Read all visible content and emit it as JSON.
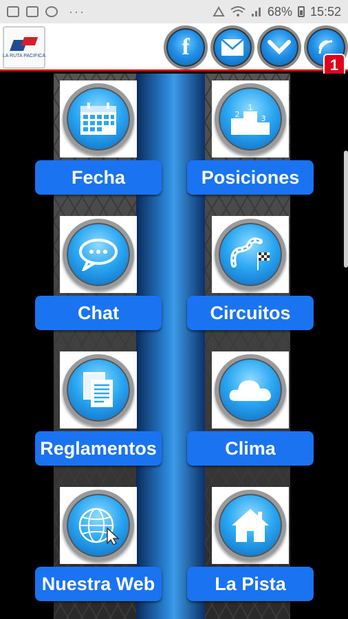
{
  "status_bar": {
    "battery": "68%",
    "time": "15:52",
    "more": "···"
  },
  "header": {
    "logo_text": "LA RUTA PACIFICA",
    "notification_count": "1",
    "buttons": [
      {
        "icon": "facebook-icon",
        "glyph": "f"
      },
      {
        "icon": "mail-icon"
      },
      {
        "icon": "down-arrow-icon"
      },
      {
        "icon": "rss-icon"
      }
    ]
  },
  "menu": {
    "items": [
      {
        "label": "Fecha",
        "icon": "calendar-icon"
      },
      {
        "label": "Posiciones",
        "icon": "podium-icon"
      },
      {
        "label": "Chat",
        "icon": "chat-bubble-icon"
      },
      {
        "label": "Circuitos",
        "icon": "circuit-flag-icon"
      },
      {
        "label": "Reglamentos",
        "icon": "documents-icon"
      },
      {
        "label": "Clima",
        "icon": "cloud-icon"
      },
      {
        "label": "Nuestra Web",
        "icon": "globe-cursor-icon"
      },
      {
        "label": "La Pista",
        "icon": "home-icon"
      }
    ]
  },
  "colors": {
    "accent_blue": "#1a73f0",
    "header_border": "#d40000",
    "badge_red": "#e0001b"
  }
}
